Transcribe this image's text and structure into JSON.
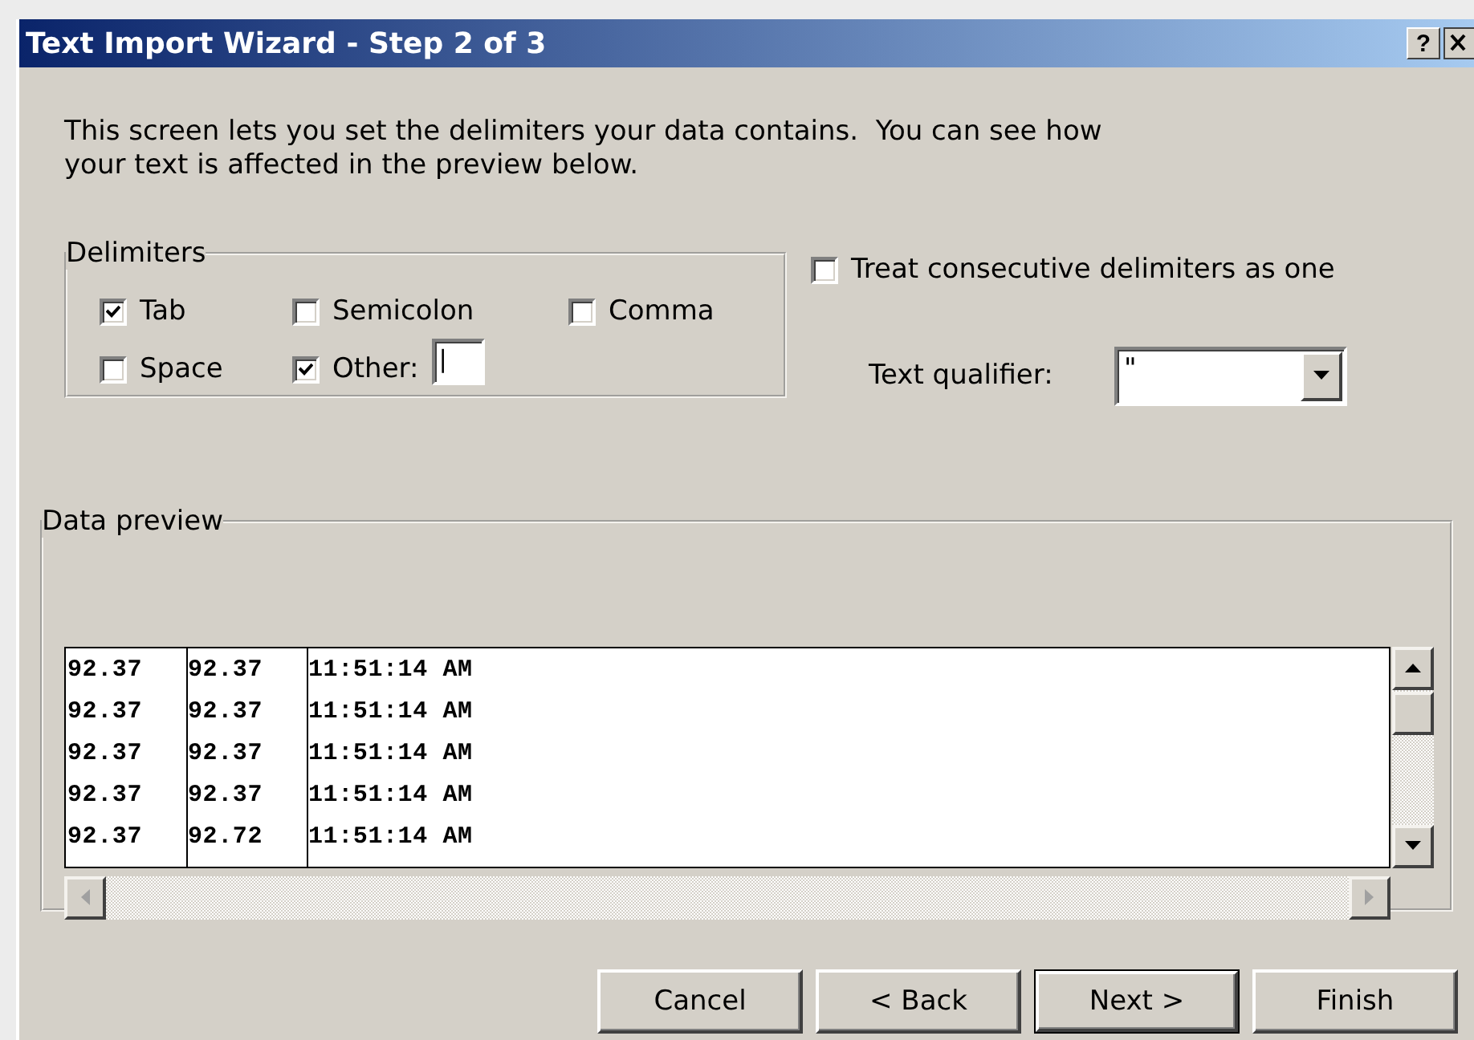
{
  "window": {
    "title": "Text Import Wizard - Step 2 of 3",
    "help": "?"
  },
  "intro": "This screen lets you set the delimiters your data contains.  You can see how your text is affected in the preview below.",
  "delimiters": {
    "title": "Delimiters",
    "options": [
      {
        "label": "Tab",
        "checked": true
      },
      {
        "label": "Semicolon",
        "checked": false
      },
      {
        "label": "Comma",
        "checked": false
      },
      {
        "label": "Space",
        "checked": false
      },
      {
        "label": "Other:",
        "checked": true
      }
    ],
    "other_value": "|"
  },
  "consecutive": {
    "label": "Treat consecutive delimiters as one",
    "checked": false
  },
  "text_qualifier": {
    "label": "Text qualifier:",
    "value": "\""
  },
  "preview": {
    "title": "Data preview",
    "rows": [
      [
        "92.37",
        "92.37",
        "11:51:14 AM"
      ],
      [
        "92.37",
        "92.37",
        "11:51:14 AM"
      ],
      [
        "92.37",
        "92.37",
        "11:51:14 AM"
      ],
      [
        "92.37",
        "92.37",
        "11:51:14 AM"
      ],
      [
        "92.37",
        "92.72",
        "11:51:14 AM"
      ]
    ]
  },
  "buttons": [
    {
      "label": "Cancel",
      "default": false
    },
    {
      "label": "< Back",
      "default": false
    },
    {
      "label": "Next >",
      "default": true
    },
    {
      "label": "Finish",
      "default": false
    }
  ]
}
